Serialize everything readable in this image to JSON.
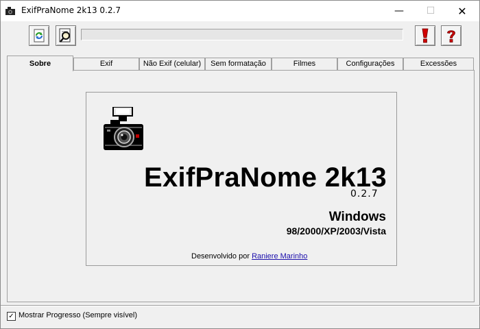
{
  "window": {
    "title": "ExifPraNome 2k13  0.2.7",
    "minimize_glyph": "—",
    "maximize_glyph": "☐",
    "close_glyph": "✕"
  },
  "toolbar": {
    "refresh_icon": "refresh-icon",
    "search_icon": "search-document-icon",
    "warning_icon": "exclamation-icon",
    "help_icon": "question-icon",
    "progress": 0
  },
  "tabs": [
    {
      "label": "Sobre",
      "active": true
    },
    {
      "label": "Exif"
    },
    {
      "label": "Não Exif (celular)"
    },
    {
      "label": "Sem formatação"
    },
    {
      "label": "Filmes"
    },
    {
      "label": "Configurações"
    },
    {
      "label": "Excessões"
    }
  ],
  "about": {
    "app_name": "ExifPraNome 2k13",
    "version": "0.2.7",
    "os_title": "Windows",
    "os_versions": "98/2000/XP/2003/Vista",
    "developed_by": "Desenvolvido por",
    "developer": "Raniere Marinho"
  },
  "footer": {
    "show_progress_label": "Mostrar Progresso (Sempre visível)",
    "show_progress_checked": true,
    "check_glyph": "✓"
  },
  "colors": {
    "window_bg": "#f0f0f0",
    "link": "#1a0dab",
    "warning_red": "#d10000",
    "refresh_green": "#2a9d2a",
    "refresh_blue": "#2a6fd1"
  }
}
